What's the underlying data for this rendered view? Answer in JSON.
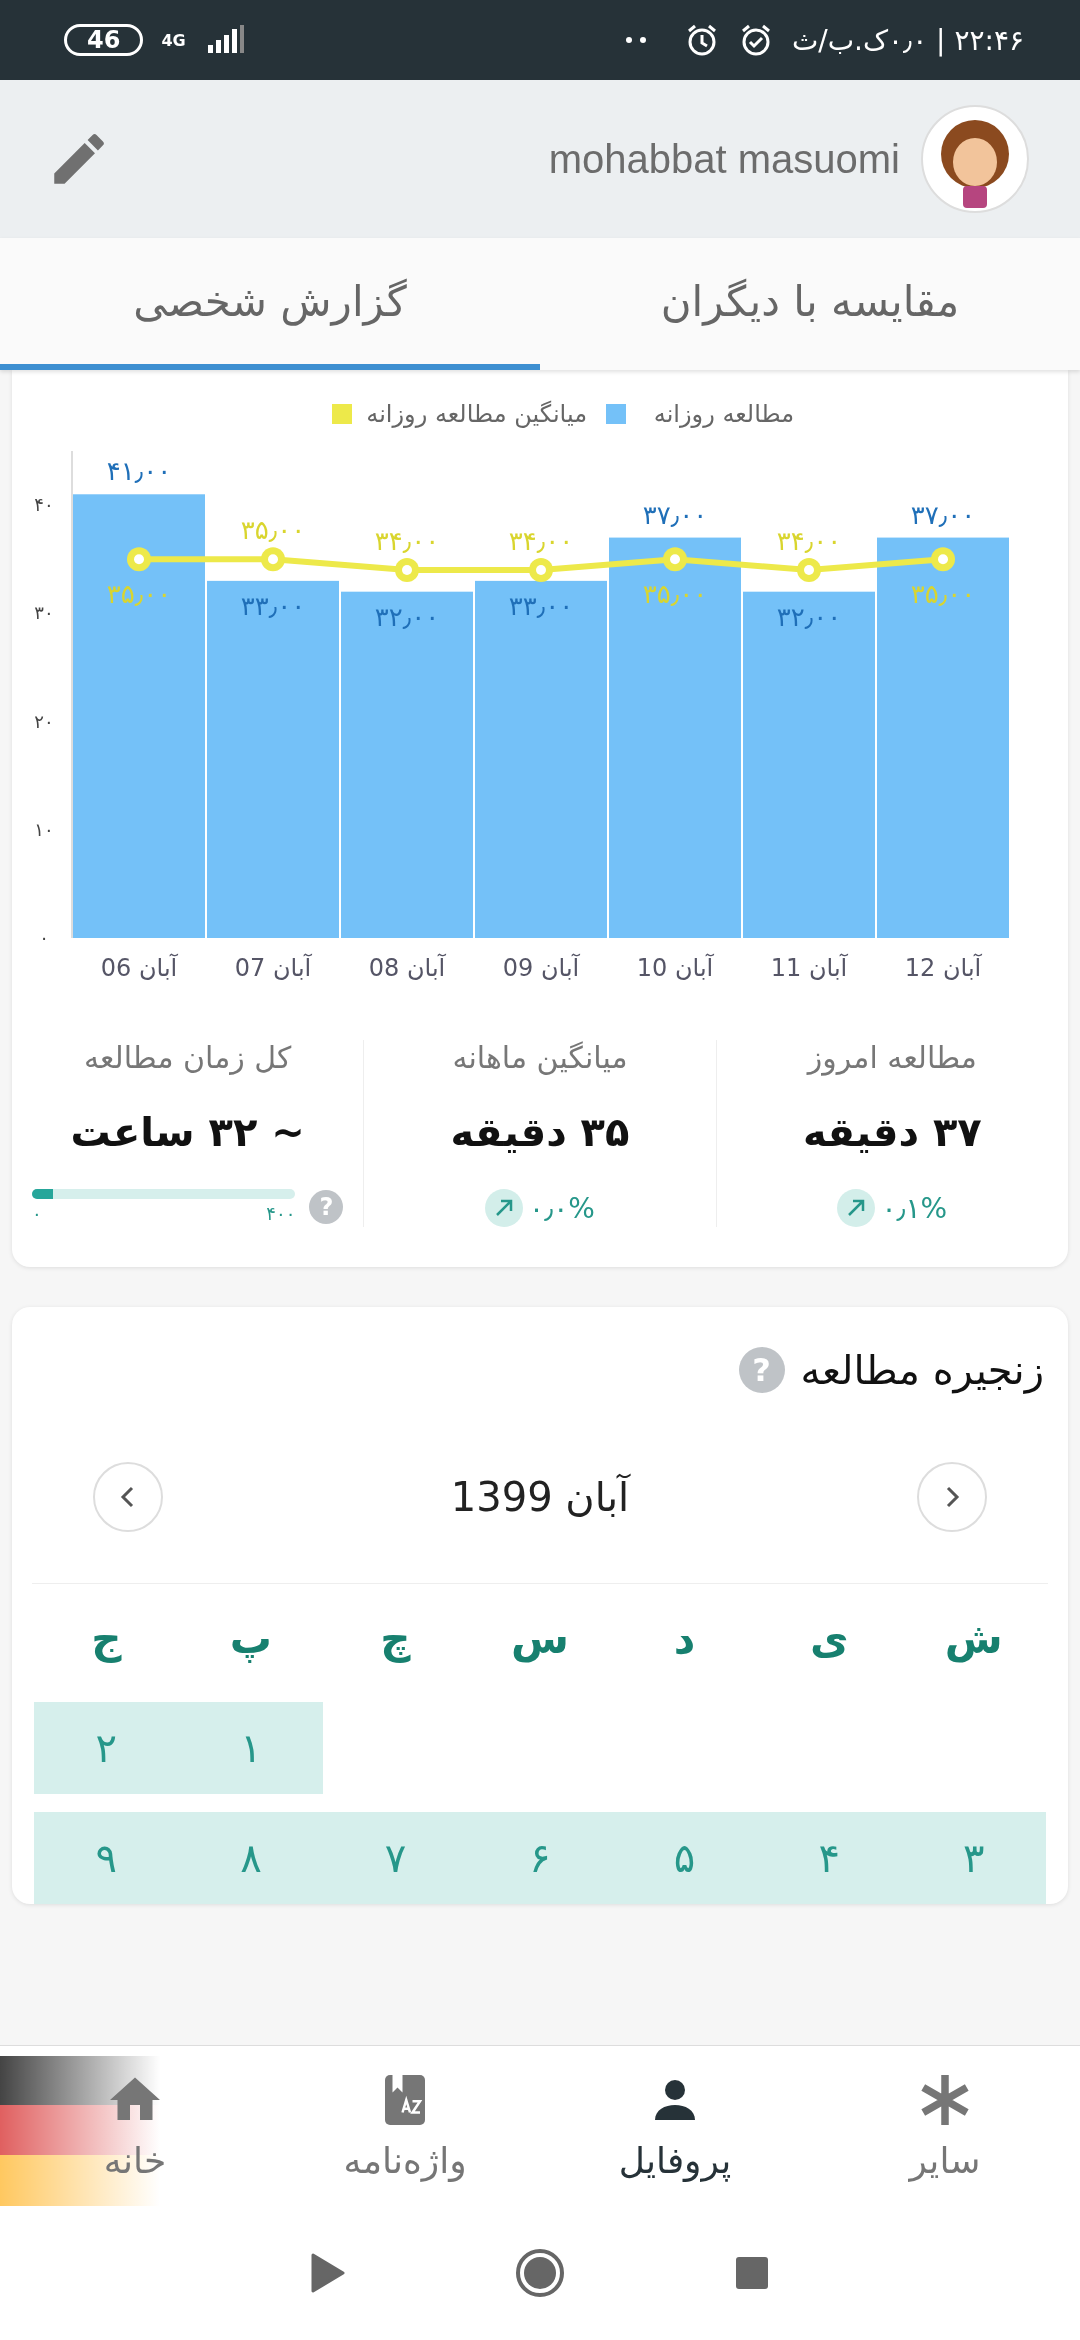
{
  "status_bar": {
    "clock": "۲۲:۴۶ | ۰٫۰ک.ب/ث",
    "network": "4G",
    "battery": "46"
  },
  "header": {
    "user_name": "mohabbat masuomi"
  },
  "tabs": [
    {
      "label": "مقایسه با دیگران",
      "selected": false
    },
    {
      "label": "گزارش شخصی",
      "selected": true
    }
  ],
  "report": {
    "chart_data": {
      "type": "bar",
      "categories": [
        "06 آبان",
        "07 آبان",
        "08 آبان",
        "09 آبان",
        "10 آبان",
        "11 آبان",
        "12 آبان"
      ],
      "series": [
        {
          "name": "مطالعه روزانه",
          "type": "bar",
          "color": "#74c1f8",
          "values": [
            41,
            33,
            32,
            33,
            37,
            32,
            37
          ],
          "value_labels": [
            "۴۱٫۰۰",
            "۳۳٫۰۰",
            "۳۲٫۰۰",
            "۳۳٫۰۰",
            "۳۷٫۰۰",
            "۳۲٫۰۰",
            "۳۷٫۰۰"
          ]
        },
        {
          "name": "میانگین مطالعه روزانه",
          "type": "line",
          "marker": "circle",
          "color": "#ede94a",
          "values": [
            35,
            35,
            34,
            34,
            35,
            34,
            35
          ],
          "value_labels": [
            "۳۵٫۰۰",
            "۳۵٫۰۰",
            "۳۴٫۰۰",
            "۳۴٫۰۰",
            "۳۵٫۰۰",
            "۳۴٫۰۰",
            "۳۵٫۰۰"
          ]
        }
      ],
      "ylim": [
        0,
        45
      ],
      "yticks": [
        {
          "value": 0,
          "label": "۰"
        },
        {
          "value": 10,
          "label": "۱۰"
        },
        {
          "value": 20,
          "label": "۲۰"
        },
        {
          "value": 30,
          "label": "۳۰"
        },
        {
          "value": 40,
          "label": "۴۰"
        }
      ],
      "legend": "top",
      "data_labels": true
    },
    "stats": [
      {
        "label": "مطالعه امروز",
        "value": "۳۷ دقیقه",
        "kind": "trend",
        "change": "۰٫۱%"
      },
      {
        "label": "میانگین ماهانه",
        "value": "۳۵ دقیقه",
        "kind": "trend",
        "change": "۰٫۰%"
      },
      {
        "label": "کل زمان مطالعه",
        "value": "~ ۳۲ ساعت",
        "kind": "progress",
        "level": 0.08,
        "min": "۰",
        "max": "۴۰۰",
        "help": "?"
      }
    ]
  },
  "streak": {
    "title": "زنجیره مطالعه",
    "help": "?",
    "month": "آبان 1399",
    "weekdays": [
      "ش",
      "ی",
      "د",
      "س",
      "چ",
      "پ",
      "ج"
    ],
    "weeks": [
      {
        "days": [
          {
            "label": "۱",
            "studied": true
          },
          {
            "label": "۲",
            "studied": true
          }
        ]
      },
      {
        "days": [
          {
            "label": "۳",
            "studied": true
          },
          {
            "label": "۴",
            "studied": true
          },
          {
            "label": "۵",
            "studied": true
          },
          {
            "label": "۶",
            "studied": true
          },
          {
            "label": "۷",
            "studied": true
          },
          {
            "label": "۸",
            "studied": true
          },
          {
            "label": "۹",
            "studied": true
          }
        ]
      }
    ]
  },
  "bottom_nav": [
    {
      "label": "سایر",
      "kind": "more",
      "selected": false
    },
    {
      "label": "پروفایل",
      "kind": "profile",
      "selected": true
    },
    {
      "label": "واژه‌نامه",
      "kind": "dictionary",
      "selected": false
    },
    {
      "label": "خانه",
      "kind": "home",
      "selected": false
    }
  ]
}
